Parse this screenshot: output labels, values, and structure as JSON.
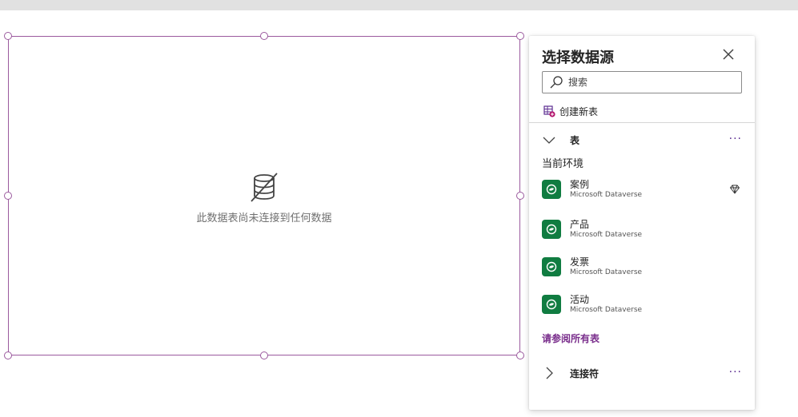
{
  "canvas": {
    "empty_message": "此数据表尚未连接到任何数据",
    "empty_icon": "database-disconnected-icon"
  },
  "panel": {
    "title": "选择数据源",
    "close_icon": "close-icon",
    "search": {
      "placeholder": "搜索",
      "value": ""
    },
    "create_table_label": "创建新表",
    "tables_section": {
      "label": "表",
      "more": "···",
      "environment_label": "当前环境",
      "items": [
        {
          "name": "案例",
          "source": "Microsoft Dataverse",
          "premium": true
        },
        {
          "name": "产品",
          "source": "Microsoft Dataverse",
          "premium": false
        },
        {
          "name": "发票",
          "source": "Microsoft Dataverse",
          "premium": false
        },
        {
          "name": "活动",
          "source": "Microsoft Dataverse",
          "premium": false
        }
      ],
      "see_all_label": "请参阅所有表"
    },
    "connectors_section": {
      "label": "连接符",
      "more": "···"
    }
  },
  "colors": {
    "selection_border": "#9b5a9e",
    "accent": "#7a2e8c",
    "dataverse_green": "#107c41",
    "top_bar": "#e1e1e1"
  }
}
